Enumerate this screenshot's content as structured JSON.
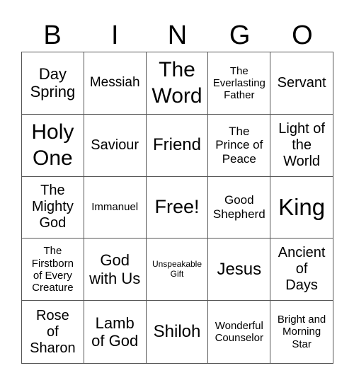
{
  "header": [
    "B",
    "I",
    "N",
    "G",
    "O"
  ],
  "cells": [
    "Day Spring",
    "Messiah",
    "The Word",
    "The Everlasting Father",
    "Servant",
    "Holy One",
    "Saviour",
    "Friend",
    "The Prince of Peace",
    "Light of the World",
    "The Mighty God",
    "Immanuel",
    "Free!",
    "Good Shepherd",
    "King",
    "The Firstborn of Every Creature",
    "God with Us",
    "Unspeakable Gift",
    "Jesus",
    "Ancient of Days",
    "Rose of Sharon",
    "Lamb of God",
    "Shiloh",
    "Wonderful Counselor",
    "Bright and Morning Star"
  ]
}
